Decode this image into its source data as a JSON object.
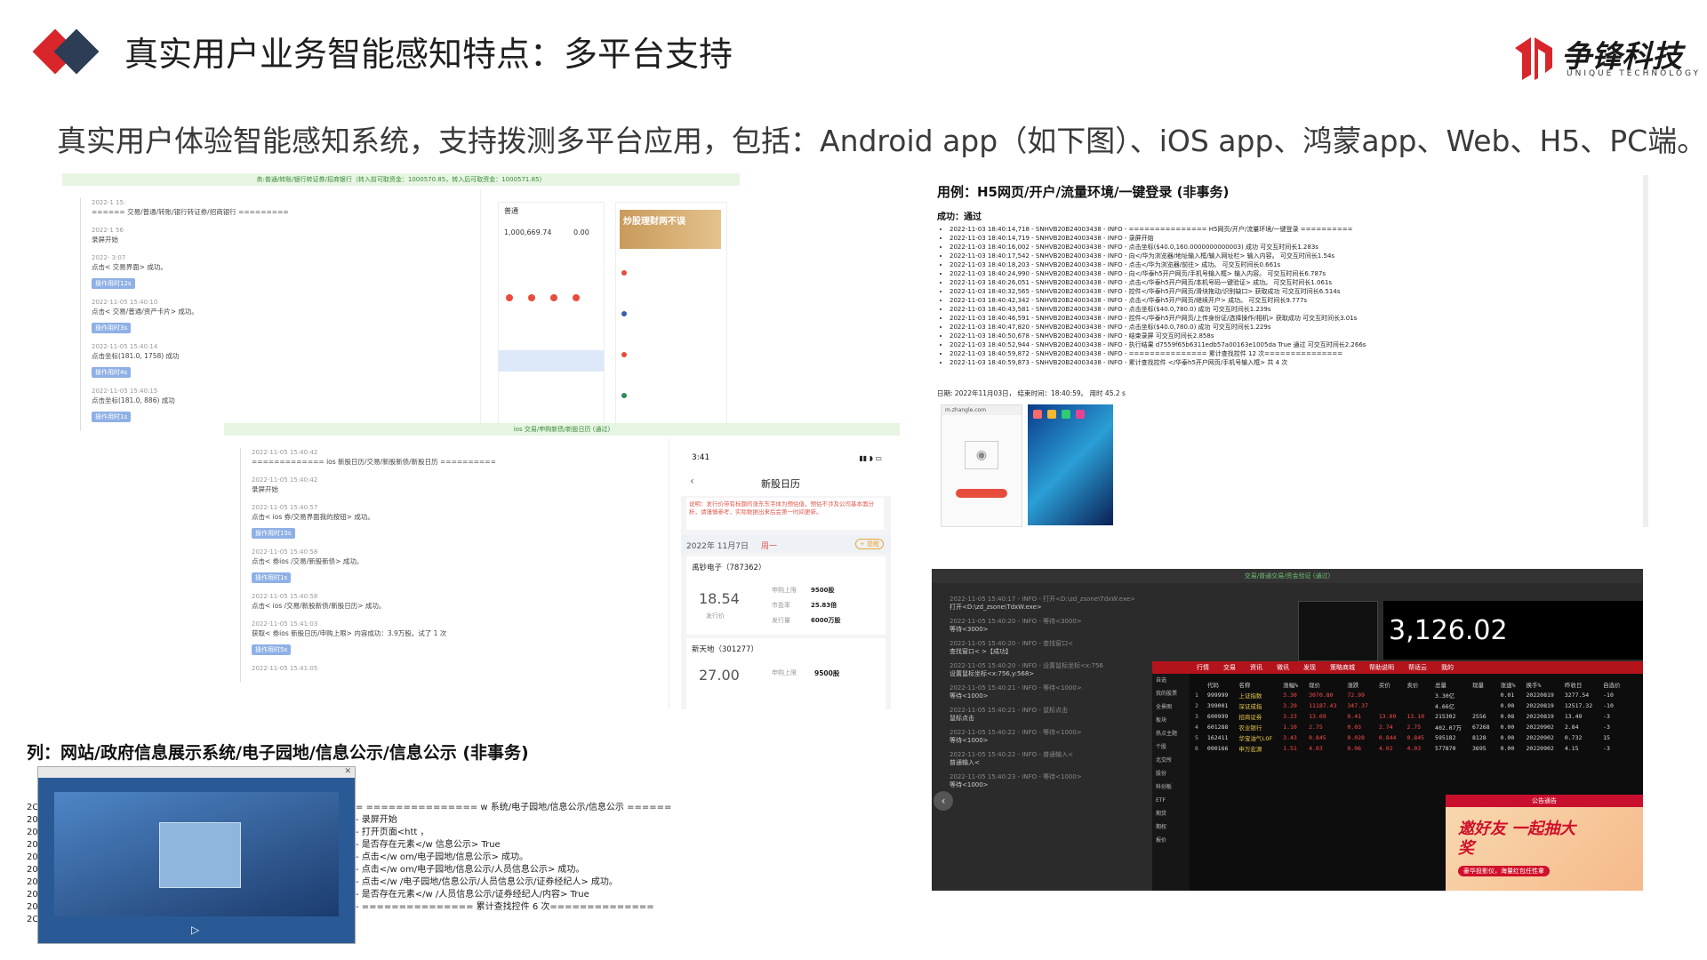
{
  "header": {
    "title": "真实用户业务智能感知特点：多平台支持",
    "subtitle": "真实用户体验智能感知系统，支持拨测多平台应用，包括：Android app（如下图）、iOS app、鸿蒙app、Web、H5、PC端。",
    "logo_text": "争锋科技",
    "logo_subtext": "UNIQUE TECHNOLOGY",
    "accent_red": "#d8262b",
    "accent_navy": "#2c3d55"
  },
  "android_shot": {
    "banner": "务:普通/转账/银行转证券/招商银行（转入前可取资金：1000570.85，转入后可取资金：1000571.85）",
    "logs": [
      {
        "time": "2022-1 15:",
        "text": "====== 交易/普通/转账/银行转证券/招商银行 =========",
        "chip": ""
      },
      {
        "time": "2022-1 56",
        "text": "录屏开始",
        "chip": ""
      },
      {
        "time": "2022- 3:07",
        "text": "点击< 交易界面> 成功。",
        "chip": "操作用时12s"
      },
      {
        "time": "2022-11-05 15:40:10",
        "text": "点击< 交易/普通/资产卡片> 成功。",
        "chip": "操作用时3s"
      },
      {
        "time": "2022-11-05 15:40:14",
        "text": "点击坐标(181.0, 1758) 成功",
        "chip": "操作用时4s"
      },
      {
        "time": "2022-11-05 15:40:15",
        "text": "点击坐标(181.0, 886) 成功",
        "chip": "操作用时1s"
      }
    ],
    "phone_tab": "普通",
    "phone_amount": "1,000,669.74",
    "phone_zero": "0.00",
    "promo_text": "炒股理财两不误"
  },
  "ios_shot": {
    "banner": "ios 交易/申购新债/新股日历 (通过)",
    "logs": [
      {
        "time": "2022-11-05 15:40:42",
        "text": "============= ios 新股日历/交易/新股新债/新股日历 ==========",
        "chip": ""
      },
      {
        "time": "2022-11-05 15:40:42",
        "text": "录屏开始",
        "chip": ""
      },
      {
        "time": "2022-11-05 15:40:57",
        "text": "点击< ios 券/交易界面我的按钮> 成功。",
        "chip": "操作用时15s"
      },
      {
        "time": "2022-11-05 15:40:58",
        "text": "点击< 券ios /交易/新股新债> 成功。",
        "chip": "操作用时1s"
      },
      {
        "time": "2022-11-05 15:40:58",
        "text": "点击< ios /交易/新股新债/新股日历> 成功。",
        "chip": ""
      },
      {
        "time": "2022-11-05 15:41:03",
        "text": "获取< 券ios 新股日历/申购上限> 内容成功：3.9万股。试了 1 次",
        "chip": "操作用时5s"
      },
      {
        "time": "2022-11-05 15:41:05",
        "text": "",
        "chip": ""
      }
    ],
    "phone": {
      "clock": "3:41",
      "title": "新股日历",
      "notice": "说明：发行价带有标题的涨东东字体为预估值，预估不涉及公司基本面分析，请谨慎参考，实际数据出来后会第一时间更新。",
      "date": "2022年 11月7日",
      "weekday": "周一",
      "remind": "+ 提醒",
      "stock1_name": "禹钞电子（787362）",
      "stock1_price": "18.54",
      "stock1_price_label": "发行价",
      "stock1_rows": [
        {
          "k": "申购上限",
          "v": "9500股"
        },
        {
          "k": "市盈率",
          "v": "25.83倍"
        },
        {
          "k": "发行量",
          "v": "6000万股"
        }
      ],
      "stock2_name": "新天地（301277）",
      "stock2_price": "27.00",
      "stock2_row_k": "申购上限",
      "stock2_row_v": "9500股"
    }
  },
  "h5_shot": {
    "title": "用例：H5网页/开户/流量环境/一键登录 (非事务)",
    "result": "成功：通过",
    "logs": [
      "2022-11-03 18:40:14,718 - SNHVB20B24003438 - INFO - =============== H5网页/开户/流量环境/一键登录 ==========",
      "2022-11-03 18:40:14,719 - SNHVB20B24003438 - INFO - 录屏开始",
      "2022-11-03 18:40:16,002 - SNHVB20B24003438 - INFO - 点击坐标($40.0,160.0000000000003) 成功  可交互时间长1.283s",
      "2022-11-03 18:40:17,542 - SNHVB20B24003438 - INFO - 向</华为浏览器/地址输入框/输入网址栏> 输入内容。 可交互时间长1.54s",
      "2022-11-03 18:40:18,203 - SNHVB20B24003438 - INFO - 点击</华为浏览器/前往> 成功。 可交互时间长0.661s",
      "2022-11-03 18:40:24,990 - SNHVB20B24003438 - INFO - 向</华泰h5开户网页/手机号输入框> 输入内容。 可交互时间长6.787s",
      "2022-11-03 18:40:26,051 - SNHVB20B24003438 - INFO - 点击</华泰h5开户网页/本机号码一键验证> 成功。 可交互时间长1.061s",
      "2022-11-03 18:40:32,565 - SNHVB20B24003438 - INFO - 控件</华泰h5开户网页/滑块拖动/识别缺口> 获取成功 可交互时间长6.514s",
      "2022-11-03 18:40:42,342 - SNHVB20B24003438 - INFO - 点击</华泰h5开户网页/继续开户> 成功。 可交互时间长9.777s",
      "2022-11-03 18:40:43,581 - SNHVB20B24003438 - INFO - 点击坐标($40.0,780.0) 成功 可交互时间长1.239s",
      "2022-11-03 18:40:46,591 - SNHVB20B24003438 - INFO - 控件</华泰h5开户网页/上传身份证/选择操作/相机> 获取成功 可交互时间长3.01s",
      "2022-11-03 18:40:47,820 - SNHVB20B24003438 - INFO - 点击坐标($40.0,780.0) 成功 可交互时间长1.229s",
      "2022-11-03 18:40:50,678 - SNHVB20B24003438 - INFO - 结束录屏 可交互时间长2.858s",
      "2022-11-03 18:40:52,944 - SNHVB20B24003438 - INFO - 执行结果 d7559f65b6311edb57a00163e1005da True 通过 可交互时间长2.266s",
      "2022-11-03 18:40:59,872 - SNHVB20B24003438 - INFO - =============== 累计查找控件 12 次===============",
      "2022-11-03 18:40:59,873 - SNHVB20B24003438 - INFO - 累计查找控件 </华泰h5开户网页/手机号输入框> 共 4 次"
    ],
    "footer": "日期: 2022年11月03日， 结束时间：18:40:59。 用时 45.2 s",
    "url": "m.zhangle.com"
  },
  "web_shot": {
    "title": "列：网站/政府信息展示系统/电子园地/信息公示/信息公示 (非事务)",
    "logs": [
      "= =============== w 系统/电子园地/信息公示/信息公示 ======",
      "- 录屏开始",
      "- 打开页面<htt ，",
      "- 是否存在元素</w 信息公示> True",
      "- 点击</w om/电子园地/信息公示> 成功。",
      "- 点击</w om/电子园地/信息公示/人员信息公示> 成功。",
      "- 点击</w /电子园地/信息公示/人员信息公示/证券经纪人> 成功。",
      "- 是否存在元素</w /人员信息公示/证券经纪人/内容> True",
      "- =============== 累计查找控件 6 次=============="
    ],
    "left_margin": [
      "2C",
      "20",
      "20",
      "20",
      "20",
      "20",
      "20",
      "20",
      "20",
      "2C"
    ]
  },
  "pc_shot": {
    "banner": "交易/普通交易/资金验证 (通过)",
    "logs": [
      {
        "time": "2022-11-05 15:40:17 - INFO - 打开<D:\\zd_zsone\\TdxW.exe>",
        "text": "打开<D:\\zd_zsone\\TdxW.exe>"
      },
      {
        "time": "2022-11-05 15:40:20 - INFO - 等待<3000>",
        "text": "等待<3000>"
      },
      {
        "time": "2022-11-05 15:40:20 - INFO - 查找窗口<",
        "text": "查找窗口< >【成功】"
      },
      {
        "time": "2022-11-05 15:40:20 - INFO - 设置鼠标坐标<x:756",
        "text": "设置鼠标坐标<x:756,y:568>"
      },
      {
        "time": "2022-11-05 15:40:21 - INFO - 等待<1000>",
        "text": "等待<1000>"
      },
      {
        "time": "2022-11-05 15:40:21 - INFO - 鼠标点击",
        "text": "鼠标点击"
      },
      {
        "time": "2022-11-05 15:40:22 - INFO - 等待<1000>",
        "text": "等待<1000>"
      },
      {
        "time": "2022-11-05 15:40:22 - INFO - 普通输入<",
        "text": "普通输入<"
      },
      {
        "time": "2022-11-05 15:40:23 - INFO - 等待<1000>",
        "text": "等待<1000>"
      }
    ],
    "index_value": "3,126.02",
    "menu": [
      "行情",
      "交易",
      "资讯",
      "微讯",
      "发现",
      "策略商城",
      "帮助说明",
      "帮适云",
      "我的"
    ],
    "side_menu": [
      "自选",
      "我的股票",
      "全景图",
      "板块",
      "热点主题",
      "个股",
      "北交所",
      "股份",
      "科创板",
      "ETF",
      "期货",
      "期权",
      "报价"
    ],
    "table_head": [
      "代码",
      "名称",
      "涨幅%",
      "现价",
      "涨跌",
      "买价",
      "卖价",
      "总量",
      "现量",
      "涨速%",
      "换手%",
      "昨收日",
      "自选价"
    ],
    "table_rows": [
      [
        "999999",
        "上证指数",
        "3.30",
        "3070.80",
        "72.99",
        "",
        "",
        "3.30亿",
        "",
        "0.01",
        "20220819",
        "3277.54",
        "-10"
      ],
      [
        "399001",
        "深证成指",
        "3.20",
        "11187.43",
        "347.37",
        "",
        "",
        "4.66亿",
        "",
        "0.00",
        "20220819",
        "12517.32",
        "-10"
      ],
      [
        "600999",
        "招商证券",
        "3.23",
        "13.09",
        "0.41",
        "13.09",
        "13.10",
        "215302",
        "2556",
        "0.08",
        "20220819",
        "13.49",
        "-3"
      ],
      [
        "601288",
        "农业银行",
        "1.10",
        "2.75",
        "0.03",
        "2.74",
        "2.75",
        "402.07万",
        "67268",
        "0.00",
        "20220902",
        "2.84",
        "-3"
      ],
      [
        "162411",
        "华宝油气LOF",
        "3.43",
        "0.845",
        "0.028",
        "0.844",
        "0.845",
        "595182",
        "8128",
        "0.00",
        "20220902",
        "0.732",
        "15"
      ],
      [
        "000166",
        "申万宏源",
        "1.51",
        "4.03",
        "0.06",
        "4.02",
        "4.03",
        "577870",
        "3695",
        "0.00",
        "20220902",
        "4.15",
        "-3"
      ]
    ],
    "ad_title": "公告通告",
    "ad_main": "邀好友 一起抽大奖",
    "ad_sub": "豪华投影仪，海量红包任性拿"
  }
}
